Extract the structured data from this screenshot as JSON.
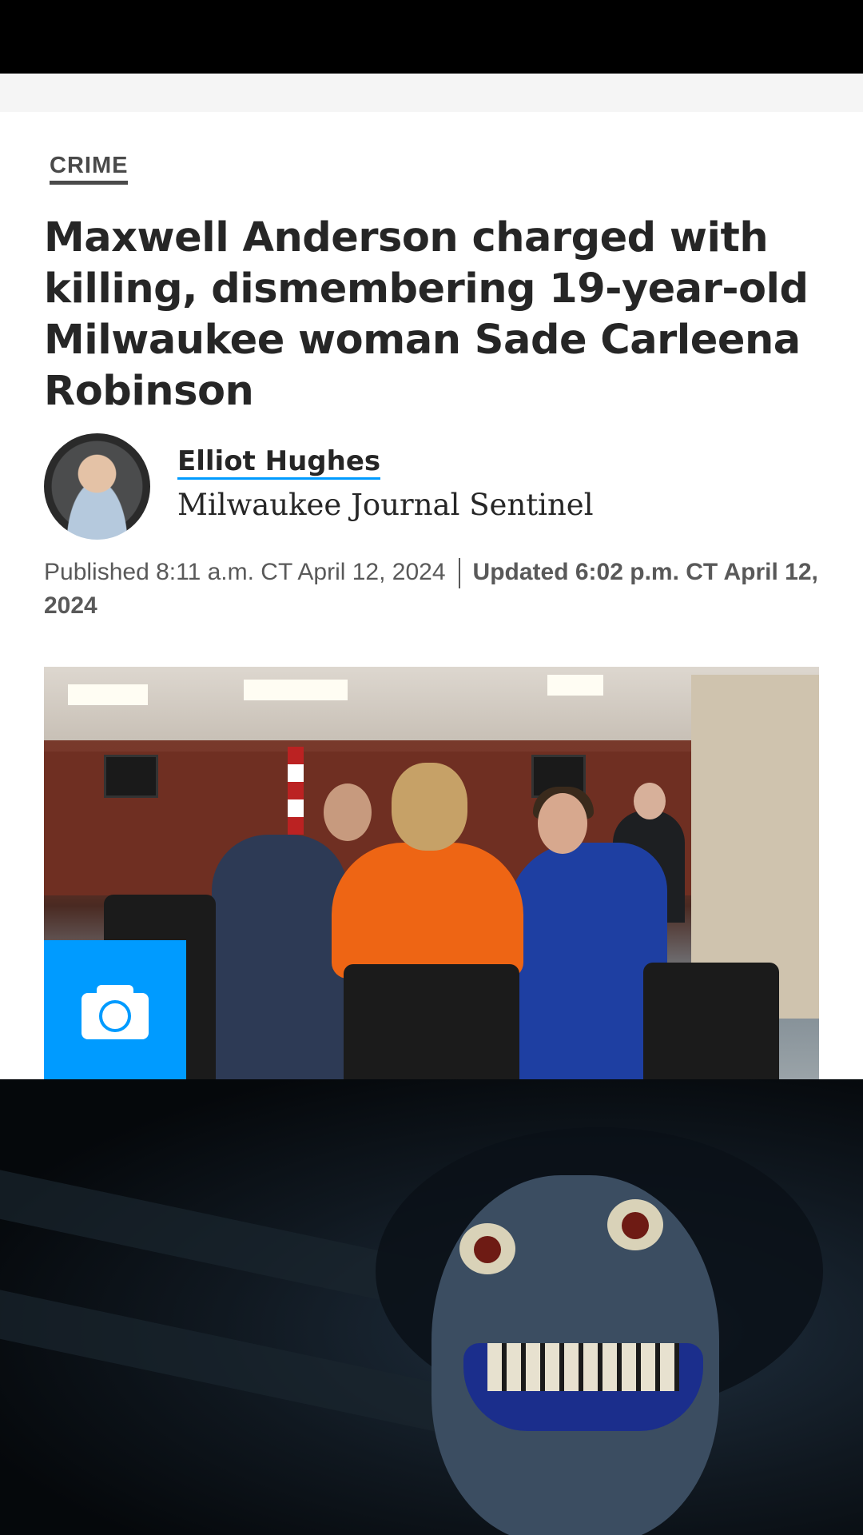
{
  "article": {
    "section": "CRIME",
    "headline": "Maxwell Anderson charged with killing, dismembering 19-year-old Milwaukee woman Sade Carleena Robinson",
    "author": "Elliot Hughes",
    "publisher": "Milwaukee Journal Sentinel",
    "published": "Published 8:11 a.m. CT April 12, 2024",
    "updated": "Updated 6:02 p.m. CT April 12, 2024"
  },
  "icons": {
    "camera": "camera-icon",
    "avatar": "author-avatar"
  },
  "colors": {
    "accent": "#009bff",
    "text": "#262626",
    "prisoner_uniform": "#ee6514"
  }
}
